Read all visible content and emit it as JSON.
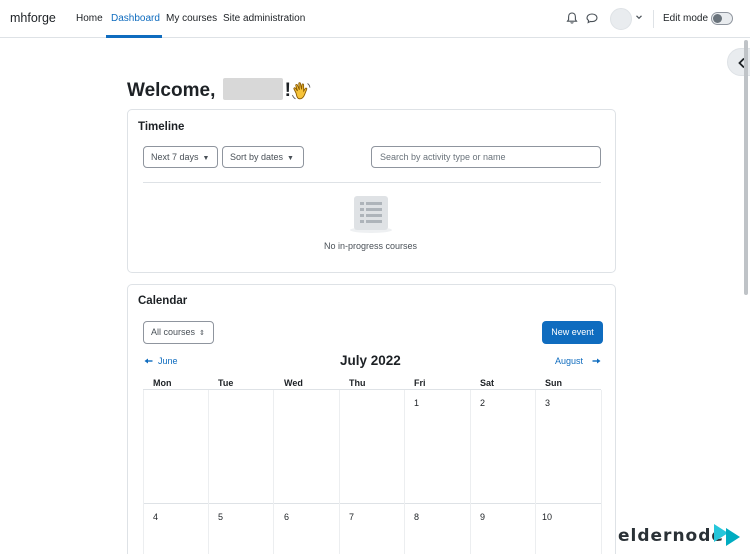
{
  "navbar": {
    "brand": "mhforge",
    "links": [
      "Home",
      "Dashboard",
      "My courses",
      "Site administration"
    ],
    "edit_mode_label": "Edit mode"
  },
  "welcome": {
    "prefix": "Welcome,",
    "suffix": "!"
  },
  "timeline": {
    "title": "Timeline",
    "filter_label": "Next 7 days",
    "sort_label": "Sort by dates",
    "search_placeholder": "Search by activity type or name",
    "empty_message": "No in-progress courses"
  },
  "calendar": {
    "title": "Calendar",
    "course_filter": "All courses",
    "new_event_label": "New event",
    "prev_month": "June",
    "next_month": "August",
    "month_title": "July 2022",
    "weekdays": [
      "Mon",
      "Tue",
      "Wed",
      "Thu",
      "Fri",
      "Sat",
      "Sun"
    ],
    "week1": [
      "",
      "",
      "",
      "",
      "1",
      "2",
      "3"
    ],
    "week2": [
      "4",
      "5",
      "6",
      "7",
      "8",
      "9",
      "10"
    ]
  },
  "watermark": "eldernode",
  "colors": {
    "accent": "#0f6cbf",
    "border": "#dee2e6",
    "text": "#1d2125"
  }
}
